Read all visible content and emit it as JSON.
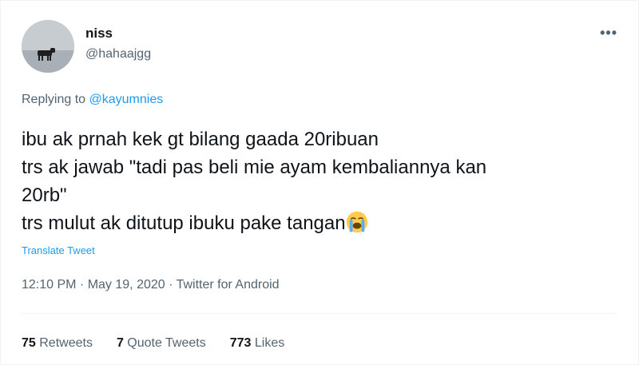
{
  "tweet": {
    "author_name": "niss",
    "author_handle": "@hahaajgg",
    "replying_prefix": "Replying to ",
    "replying_to": "@kayumnies",
    "lines": [
      "ibu ak prnah kek gt bilang gaada 20ribuan",
      "trs ak jawab \"tadi pas beli mie ayam kembaliannya kan",
      "20rb\"",
      "trs mulut ak ditutup ibuku pake tangan"
    ],
    "emoji_icon": "loudly-crying-face-icon",
    "translate_label": "Translate Tweet",
    "time": "12:10 PM",
    "separator": " · ",
    "date": "May 19, 2020",
    "source": "Twitter for Android",
    "more_icon": "more-options-icon"
  },
  "stats": {
    "retweets_count": "75",
    "retweets_label": " Retweets",
    "quotes_count": "7",
    "quotes_label": " Quote Tweets",
    "likes_count": "773",
    "likes_label": " Likes"
  },
  "colors": {
    "link": "#1d9bf0",
    "secondary_text": "#536471",
    "primary_text": "#0f1419",
    "divider": "#eff3f4"
  }
}
